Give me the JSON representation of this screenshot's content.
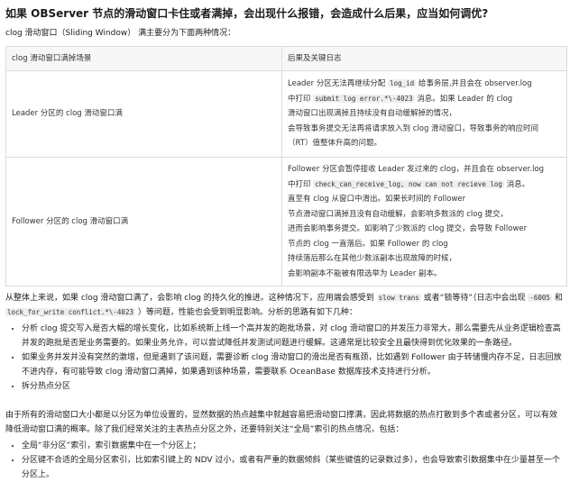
{
  "title": "如果 OBServer 节点的滑动窗口卡住或者满掉，会出现什么报错，会造成什么后果，应当如何调优?",
  "intro": "clog 滑动窗口（Sliding Window） 满主要分为下面两种情况：",
  "table": {
    "headers": [
      "clog 滑动窗口满掉场景",
      "后果及关键日志"
    ],
    "rows": [
      {
        "scenario": "Leader 分区的 clog 滑动窗口满",
        "lines": [
          {
            "pre": "Leader 分区无法再继续分配 ",
            "code": "log_id",
            "post": " 给事务层,并且会在 observer.log"
          },
          {
            "pre": "中打印 ",
            "code": "submit log error.*\\-4023",
            "post": " 消息。如果 Leader 的 clog"
          },
          {
            "pre": "滑动窗口出现满掉且持续没有自动缓解掉的情况，",
            "code": "",
            "post": ""
          },
          {
            "pre": "会导致事务提交无法再将请求放入到 clog 滑动窗口，导致事务的响应时间",
            "code": "",
            "post": ""
          },
          {
            "pre": "（RT）值整体升高的问题。",
            "code": "",
            "post": ""
          }
        ]
      },
      {
        "scenario": "Follower 分区的 clog 滑动窗口满",
        "lines": [
          {
            "pre": "Follower 分区会暂停接收 Leader 发过来的 clog，并且会在 observer.log",
            "code": "",
            "post": ""
          },
          {
            "pre": "中打印 ",
            "code": "check_can_receive_log, now can not recieve log",
            "post": " 消息。"
          },
          {
            "pre": "直至有 clog 从窗口中滑出。如果长时间的 Follower",
            "code": "",
            "post": ""
          },
          {
            "pre": "节点滑动窗口满掉且没有自动缓解，会影响多数派的 clog 提交，",
            "code": "",
            "post": ""
          },
          {
            "pre": "进而会影响事务提交。如影响了少数派的 clog 提交，会导致 Follower",
            "code": "",
            "post": ""
          },
          {
            "pre": "节点的 clog 一直落后。如果 Follower 的 clog",
            "code": "",
            "post": ""
          },
          {
            "pre": "持续落后那么在其他少数派副本出现故障的时候，",
            "code": "",
            "post": ""
          },
          {
            "pre": "会影响副本不能被有限选举为 Leader 副本。",
            "code": "",
            "post": ""
          }
        ]
      }
    ]
  },
  "para1": {
    "p1": "从整体上来说，如果 clog 滑动窗口满了，会影响 clog 的持久化的推进。这种情况下，应用端会感受到 ",
    "code1": "slow trans",
    "p2": " 或者“锁等待”（日志中会出现 ",
    "code2": "-6005",
    "p3": " 和",
    "code3": "lock_for_write conflict.*\\-4023",
    "p4": " ）等问题，性能也会受到明显影响。分析的思路有如下几种："
  },
  "bullets1": [
    "分析 clog 提交写入是否大幅的增长变化，比如系统新上线一个高并发的跑批场景，对 clog 滑动窗口的并发压力非常大，那么需要先从业务逻辑检查高并发的跑批是否是业务需要的。如果业务允许，可以尝试降低并发测试问题进行缓解。这通常是比较安全且最快得到优化效果的一条路径。",
    "如果业务并发并没有突然的激增，但是遇到了该问题，需要诊断 clog 滑动窗口的滑出是否有瓶颈，比如遇到 Follower 由于转储慢内存不足，日志回放不进内存，有可能导致 clog 滑动窗口满掉，如果遇到该种场景，需要联系 OceanBase 数据库技术支持进行分析。",
    "拆分热点分区"
  ],
  "para2": "由于所有的滑动窗口大小都是以分区为单位设置的，显然数据的热点越集中就越容易把滑动窗口撑满，因此将数据的热点打散到多个表或者分区，可以有效降低滑动窗口满的概率。除了我们经常关注的主表热点分区之外，还要特别关注“全局”索引的热点情况，包括：",
  "bullets2": [
    "全局“非分区”索引，索引数据集中在一个分区上；",
    "分区键不合适的全局分区索引，比如索引键上的 NDV 过小，或者有严重的数据倾斜（某些键值的记录数过多），也会导致索引数据集中在少量甚至一个分区上。"
  ]
}
